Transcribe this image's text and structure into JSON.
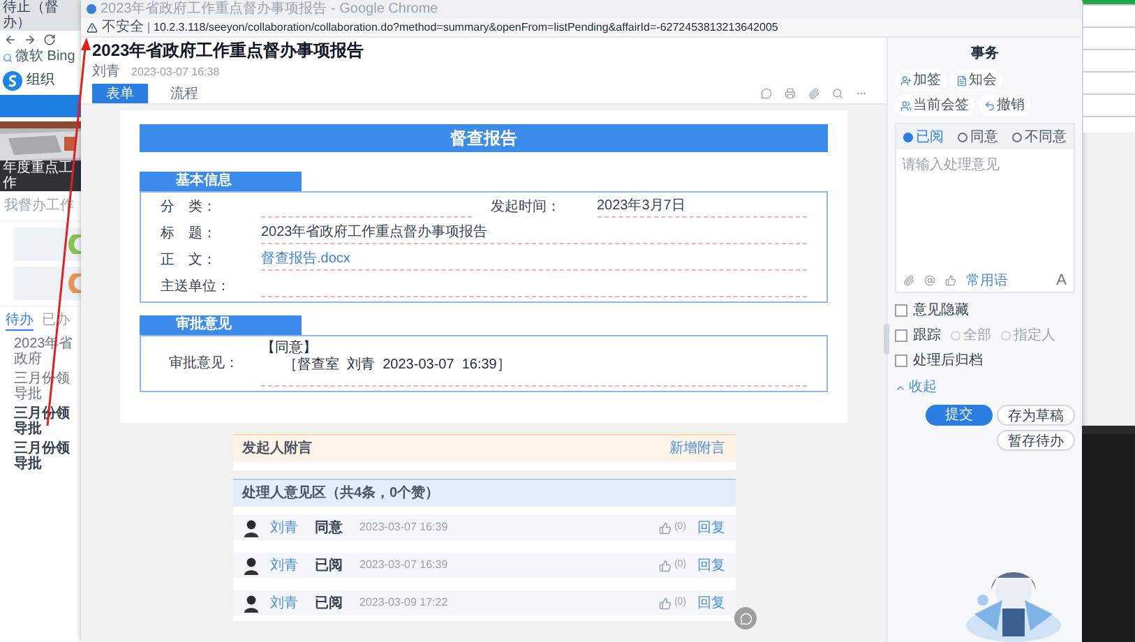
{
  "background_app": {
    "tab_title": "待止（督办）",
    "bookmark": "微软 Bing",
    "logo_text": "组织",
    "banner_caption": "年度重点工作",
    "section_tab": "我督办工作",
    "list_tabs": [
      {
        "label": "待办",
        "selected": true
      },
      {
        "label": "已办",
        "selected": false
      }
    ],
    "list_items": [
      {
        "text": "2023年省政府",
        "bold": false
      },
      {
        "text": "三月份领导批",
        "bold": false
      },
      {
        "text": "三月份领导批",
        "bold": true
      },
      {
        "text": "三月份领导批",
        "bold": true
      }
    ]
  },
  "browser": {
    "title": "2023年省政府工作重点督办事项报告 - Google Chrome",
    "security": "不安全",
    "url": "10.2.3.118/seeyon/collaboration/collaboration.do?method=summary&openFrom=listPending&affairId=-6272453813213642005"
  },
  "header": {
    "title": "2023年省政府工作重点督办事项报告",
    "author": "刘青",
    "time": "2023-03-07 16:38"
  },
  "tabs": [
    {
      "label": "表单",
      "selected": true
    },
    {
      "label": "流程",
      "selected": false
    }
  ],
  "form": {
    "title": "督查报告",
    "basic": {
      "heading": "基本信息",
      "category_label": "分　类：",
      "start_label": "发起时间：",
      "start_value": "2023年3月7日",
      "subject_label": "标　题：",
      "subject_value": "2023年省政府工作重点督办事项报告",
      "body_label": "正　文：",
      "body_value": "督查报告.docx",
      "recipient_label": "主送单位："
    },
    "approval": {
      "heading": "审批意见",
      "label": "审批意见：",
      "lines": [
        "【同意】",
        "［督查室  刘青  2023-03-07  16:39］"
      ]
    }
  },
  "attachments": {
    "title": "发起人附言",
    "action": "新增附言"
  },
  "comments": {
    "title": "处理人意见区（共4条，0个赞）",
    "items": [
      {
        "name": "刘青",
        "action": "同意",
        "time": "2023-03-07 16:39",
        "likes": "(0)",
        "reply": "回复"
      },
      {
        "name": "刘青",
        "action": "已阅",
        "time": "2023-03-07 16:39",
        "likes": "(0)",
        "reply": "回复"
      },
      {
        "name": "刘青",
        "action": "已阅",
        "time": "2023-03-09 17:22",
        "likes": "(0)",
        "reply": "回复"
      }
    ]
  },
  "side_panel": {
    "title": "事务",
    "actions": [
      "加签",
      "知会",
      "当前会签",
      "撤销"
    ],
    "attitudes": [
      {
        "label": "已阅",
        "selected": true
      },
      {
        "label": "同意",
        "selected": false
      },
      {
        "label": "不同意",
        "selected": false
      }
    ],
    "placeholder": "请输入处理意见",
    "phrases": "常用语",
    "font_button": "A",
    "options": [
      {
        "kind": "checkbox",
        "label": "意见隐藏",
        "checked": false
      },
      {
        "kind": "track",
        "label": "跟踪",
        "checked": false,
        "choices": [
          {
            "label": "全部",
            "selected": false
          },
          {
            "label": "指定人",
            "selected": false
          }
        ]
      },
      {
        "kind": "checkbox",
        "label": "处理后归档",
        "checked": false
      }
    ],
    "collapse": "收起",
    "buttons": [
      {
        "label": "提交",
        "primary": true
      },
      {
        "label": "存为草稿",
        "primary": false
      },
      {
        "label": "暂存待办",
        "primary": false
      }
    ]
  }
}
